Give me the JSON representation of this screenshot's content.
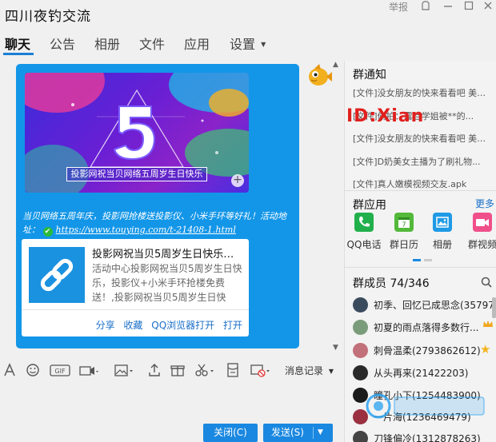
{
  "window": {
    "title": "四川夜钓交流",
    "report": "举报"
  },
  "tabs": [
    {
      "label": "聊天"
    },
    {
      "label": "公告"
    },
    {
      "label": "相册"
    },
    {
      "label": "文件"
    },
    {
      "label": "应用"
    },
    {
      "label": "设置"
    }
  ],
  "message": {
    "banner_caption": "投影网祝当贝网络五周岁生日快乐",
    "text": "当贝网络五周年庆，投影网抢楼送投影仪、小米手环等好礼！活动地址：",
    "link": "https://www.touying.com/t-21408-1.html",
    "card": {
      "title": "投影网祝当贝5周岁生日快乐，...",
      "desc": "活动中心投影网祝当贝5周岁生日快乐，投影仪+小米手环抢楼免费送！,投影网祝当贝5周岁生日快乐，...",
      "actions": [
        "分享",
        "收藏",
        "QQ浏览器打开",
        "打开"
      ]
    }
  },
  "toolbar": {
    "history": "消息记录"
  },
  "input": {
    "close": "关闭(C)",
    "send": "发送(S)"
  },
  "notices": {
    "title": "群通知",
    "items": [
      {
        "tag": "[文件]",
        "text": "没女朋友的快来看看吧 美女..."
      },
      {
        "tag": "[文件]",
        "text": "偷拍：露脸学姐被**的..."
      },
      {
        "tag": "[文件]",
        "text": "没女朋友的快来看看吧 美女..."
      },
      {
        "tag": "[文件]",
        "text": "D奶美女主播为了刷礼物..."
      },
      {
        "tag": "[文件]",
        "text": "真人嫩模视频交友.apk"
      }
    ],
    "watermark": "ID:Xian"
  },
  "apps": {
    "title": "群应用",
    "more": "更多",
    "items": [
      {
        "label": "QQ电话",
        "color": "#21b04b"
      },
      {
        "label": "群日历",
        "color": "#53b93a"
      },
      {
        "label": "相册",
        "color": "#1e9ae6"
      },
      {
        "label": "群视频",
        "color": "#f0508a"
      }
    ]
  },
  "members": {
    "title": "群成员 74/346",
    "list": [
      {
        "name": "初季、回忆已成思念(35797...",
        "color": "#3a4b5e"
      },
      {
        "name": "初夏的雨点落得多数行...",
        "color": "#7a9c7a"
      },
      {
        "name": "刺骨温柔(2793862612)",
        "color": "#c2707a"
      },
      {
        "name": "从头再来(21422203)",
        "color": "#2a2a2a"
      },
      {
        "name": "瞳孔小下(1254483900)",
        "color": "#1b1b1b"
      },
      {
        "name": "一片海(1236469479)",
        "color": "#9a3040"
      },
      {
        "name": "刀锋偏冷(1312878263)",
        "color": "#444"
      }
    ]
  }
}
